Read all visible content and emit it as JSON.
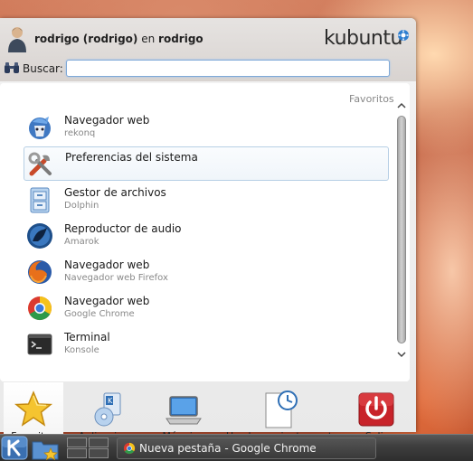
{
  "header": {
    "user_name": "rodrigo (rodrigo)",
    "connector": "en",
    "host": "rodrigo",
    "brand": "kubuntu"
  },
  "search": {
    "label": "Buscar:",
    "value": "",
    "placeholder": ""
  },
  "list": {
    "section_label": "Favoritos",
    "items": [
      {
        "title": "Navegador web",
        "subtitle": "rekonq",
        "icon": "rekonq-icon"
      },
      {
        "title": "Preferencias del sistema",
        "subtitle": "",
        "icon": "system-settings-icon"
      },
      {
        "title": "Gestor de archivos",
        "subtitle": "Dolphin",
        "icon": "dolphin-icon"
      },
      {
        "title": "Reproductor de audio",
        "subtitle": "Amarok",
        "icon": "amarok-icon"
      },
      {
        "title": "Navegador web",
        "subtitle": "Navegador web Firefox",
        "icon": "firefox-icon"
      },
      {
        "title": "Navegador web",
        "subtitle": "Google Chrome",
        "icon": "chrome-icon"
      },
      {
        "title": "Terminal",
        "subtitle": "Konsole",
        "icon": "konsole-icon"
      }
    ]
  },
  "tabs": [
    {
      "label": "Favoritos",
      "icon": "star-icon",
      "active": true
    },
    {
      "label": "Aplicaciones",
      "icon": "applications-icon",
      "active": false
    },
    {
      "label": "Máquina",
      "icon": "computer-icon",
      "active": false
    },
    {
      "label": "Usados recientemente",
      "icon": "recent-documents-icon",
      "active": false
    },
    {
      "label": "Salir",
      "icon": "power-icon",
      "active": false
    }
  ],
  "taskbar": {
    "task_label": "Nueva pestaña - Google Chrome"
  },
  "colors": {
    "selection_border": "#b7cfe5",
    "search_focus": "#7fa9d8",
    "power_red": "#c8232a",
    "taskbar_bg": "#3f3f3f"
  }
}
